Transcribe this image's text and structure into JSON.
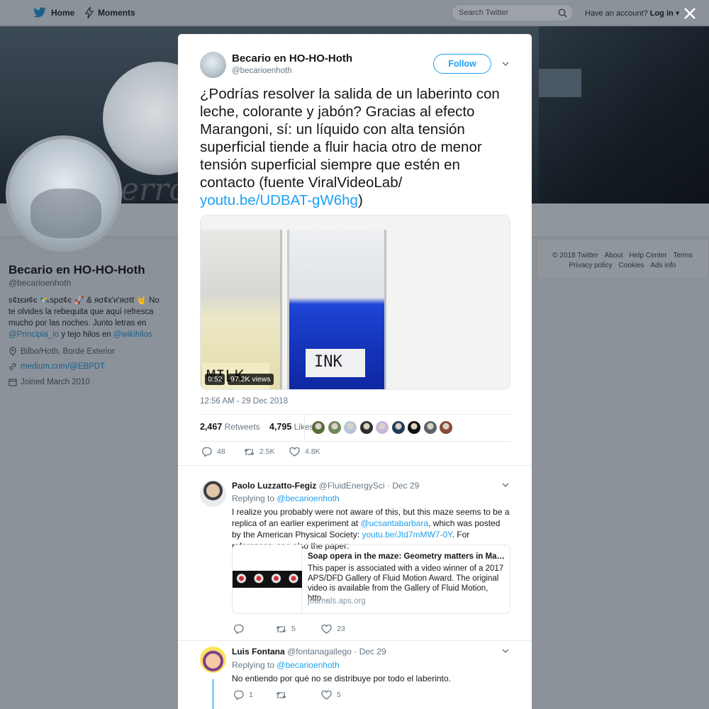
{
  "nav": {
    "home_label": "Home",
    "moments_label": "Moments",
    "search_placeholder": "Search Twitter",
    "account_prompt": "Have an account?",
    "login_label": "Log in"
  },
  "profile": {
    "name": "Becario en HO-HO-Hoth",
    "handle": "@becarioenhoth",
    "bio_text": "s¢ɪєи¢є 🛰️spα¢є 🚀 & яσ¢к'и'яσℓℓ 🤘 No te olvides la rebequita que aquí refresca mucho por las noches. Junto letras en",
    "bio_link1": "@Principia_io",
    "bio_mid": "y tejo hilos en",
    "bio_link2": "@wikihilos",
    "location": "Bilbo/Hoth, Borde Exterior",
    "website": "medium.com/@EBPDT",
    "joined": "Joined March 2010"
  },
  "footer": {
    "links_row1": [
      "© 2018 Twitter",
      "About",
      "Help Center",
      "Terms"
    ],
    "links_row2": [
      "Privacy policy",
      "Cookies",
      "Ads info"
    ]
  },
  "tweet": {
    "author_name": "Becario en HO-HO-Hoth",
    "author_handle": "@becarioenhoth",
    "follow_label": "Follow",
    "text": "¿Podrías resolver la salida de un laberinto con leche, colorante y jabón? Gracias al efecto Marangoni, sí: un líquido con alta tensión superficial tiende a fluir hacia otro de menor tensión superficial siempre que estén en contacto (fuente ViralVideoLab/",
    "text_link": "youtu.be/UDBAT-gW6hg",
    "text_end": ")",
    "media": {
      "label_left": "MILK",
      "label_right": "INK",
      "duration": "0:52",
      "views": "97.2K views"
    },
    "timestamp": "12:56 AM - 29 Dec 2018",
    "retweets_count": "2,467",
    "retweets_label": "Retweets",
    "likes_count": "4,795",
    "likes_label": "Likes",
    "liker_colors": [
      "#5a6b3c",
      "#6f8a5a",
      "#b7c6d6",
      "#2e2e2e",
      "#c9b6d9",
      "#1f3b5c",
      "#101010",
      "#5c636b",
      "#8a4a3a"
    ],
    "actions": {
      "replies": "48",
      "retweets": "2.5K",
      "likes": "4.8K"
    }
  },
  "replies": [
    {
      "name": "Paolo Luzzatto-Fegiz",
      "handle": "@FluidEnergySci",
      "date": "· Dec 29",
      "replying_label": "Replying to",
      "replying_to": "@becarioenhoth",
      "text_a": "I realize you probably were not aware of this, but this maze seems to be a replica of an earlier experiment at",
      "link_a": "@ucsantabarbara",
      "text_b": ", which was posted by the American Physical Society:",
      "link_b": "youtu.be/Jtd7mMW7-0Y",
      "text_c": ". For references, see also the paper:",
      "card": {
        "title": "Soap opera in the maze: Geometry matters in Marangoni...",
        "description": "This paper is associated with a video winner of a 2017 APS/DFD Gallery of Fluid Motion Award. The original video is available from the Gallery of Fluid Motion, http...",
        "domain": "journals.aps.org"
      },
      "actions": {
        "replies": "",
        "retweets": "5",
        "likes": "23"
      }
    },
    {
      "name": "Luis Fontana",
      "handle": "@fontanagallego",
      "date": "· Dec 29",
      "replying_label": "Replying to",
      "replying_to": "@becarioenhoth",
      "text": "No entiendo por qué no se distribuye por todo el laberinto.",
      "actions": {
        "replies": "1",
        "retweets": "",
        "likes": "5"
      }
    }
  ],
  "colors": {
    "accent": "#1da1f2",
    "overlay": "#8b929a",
    "text": "#14171a",
    "muted": "#657786"
  }
}
